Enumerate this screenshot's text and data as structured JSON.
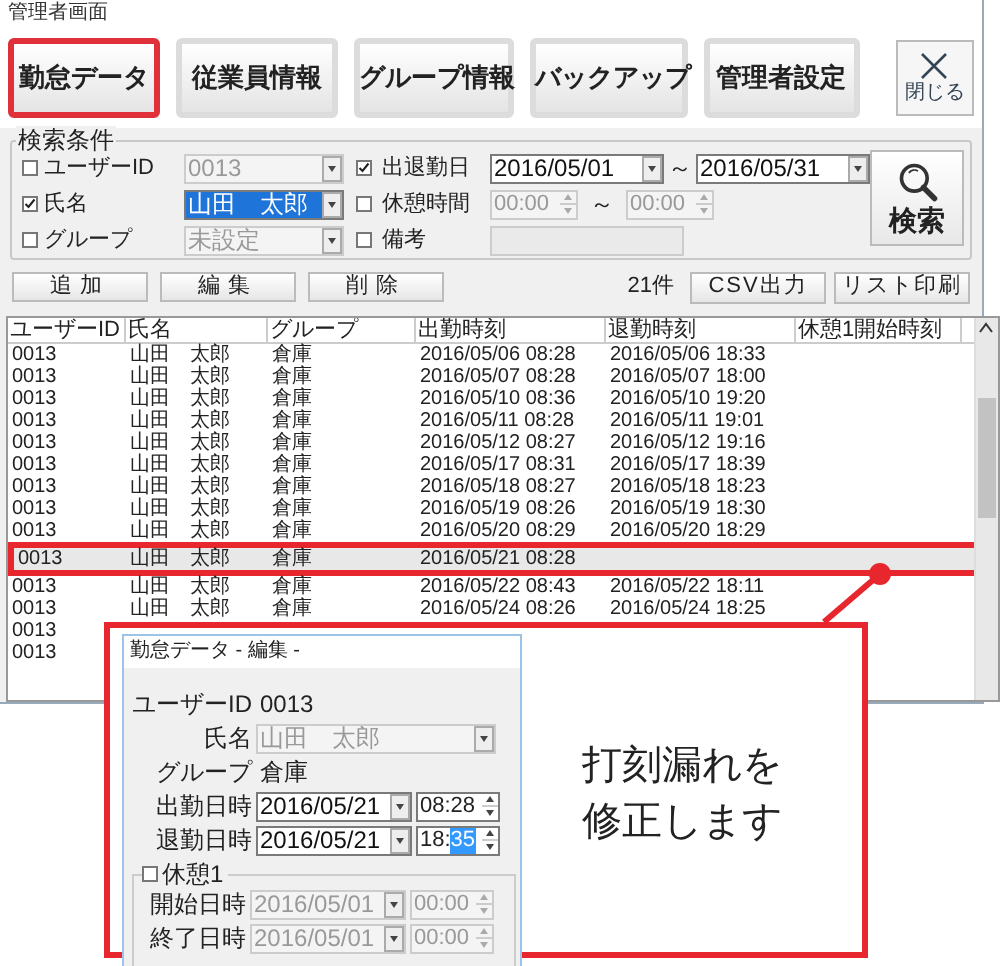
{
  "window": {
    "title": "管理者画面"
  },
  "toolbar": [
    {
      "label": "勤怠データ",
      "selected": true
    },
    {
      "label": "従業員情報",
      "selected": false
    },
    {
      "label": "グループ情報",
      "selected": false
    },
    {
      "label": "バックアップ",
      "selected": false
    },
    {
      "label": "管理者設定",
      "selected": false
    }
  ],
  "close_button": {
    "label": "閉じる"
  },
  "search": {
    "title": "検索条件",
    "button": "検索",
    "user_id": {
      "label": "ユーザーID",
      "checked": false,
      "value": "0013"
    },
    "name": {
      "label": "氏名",
      "checked": true,
      "value": "山田　太郎"
    },
    "group": {
      "label": "グループ",
      "checked": false,
      "value": "未設定"
    },
    "work_date": {
      "label": "出退勤日",
      "checked": true,
      "from": "2016/05/01",
      "separator": "～",
      "to": "2016/05/31"
    },
    "break_time": {
      "label": "休憩時間",
      "checked": false,
      "from": "00:00",
      "separator": "～",
      "to": "00:00"
    },
    "note": {
      "label": "備考",
      "checked": false
    }
  },
  "actions": [
    "追加",
    "編集",
    "削除"
  ],
  "count": "21件",
  "exports": [
    "CSV出力",
    "リスト印刷"
  ],
  "table": {
    "columns": [
      "ユーザーID",
      "氏名",
      "グループ",
      "出勤時刻",
      "退勤時刻",
      "休憩1開始時刻"
    ],
    "rows": [
      {
        "cells": [
          "0013",
          "山田　太郎",
          "倉庫",
          "2016/05/06 08:28",
          "2016/05/06 18:33"
        ],
        "selected": false
      },
      {
        "cells": [
          "0013",
          "山田　太郎",
          "倉庫",
          "2016/05/07 08:28",
          "2016/05/07 18:00"
        ],
        "selected": false
      },
      {
        "cells": [
          "0013",
          "山田　太郎",
          "倉庫",
          "2016/05/10 08:36",
          "2016/05/10 19:20"
        ],
        "selected": false
      },
      {
        "cells": [
          "0013",
          "山田　太郎",
          "倉庫",
          "2016/05/11 08:28",
          "2016/05/11 19:01"
        ],
        "selected": false
      },
      {
        "cells": [
          "0013",
          "山田　太郎",
          "倉庫",
          "2016/05/12 08:27",
          "2016/05/12 19:16"
        ],
        "selected": false
      },
      {
        "cells": [
          "0013",
          "山田　太郎",
          "倉庫",
          "2016/05/17 08:31",
          "2016/05/17 18:39"
        ],
        "selected": false
      },
      {
        "cells": [
          "0013",
          "山田　太郎",
          "倉庫",
          "2016/05/18 08:27",
          "2016/05/18 18:23"
        ],
        "selected": false
      },
      {
        "cells": [
          "0013",
          "山田　太郎",
          "倉庫",
          "2016/05/19 08:26",
          "2016/05/19 18:30"
        ],
        "selected": false
      },
      {
        "cells": [
          "0013",
          "山田　太郎",
          "倉庫",
          "2016/05/20 08:29",
          "2016/05/20 18:29"
        ],
        "selected": false
      },
      {
        "cells": [
          "0013",
          "山田　太郎",
          "倉庫",
          "2016/05/21 08:28"
        ],
        "selected": true
      },
      {
        "cells": [
          "0013",
          "山田　太郎",
          "倉庫",
          "2016/05/22 08:43",
          "2016/05/22 18:11"
        ],
        "selected": false
      },
      {
        "cells": [
          "0013",
          "山田　太郎",
          "倉庫",
          "2016/05/24 08:26",
          "2016/05/24 18:25"
        ],
        "selected": false
      },
      {
        "cells": [
          "0013"
        ],
        "selected": false
      },
      {
        "cells": [
          "0013"
        ],
        "selected": false
      }
    ]
  },
  "callout": {
    "message": [
      "打刻漏れを",
      "修正します"
    ],
    "dialog": {
      "title": "勤怠データ - 編集 -",
      "user_id": {
        "label": "ユーザーID",
        "value": "0013"
      },
      "name": {
        "label": "氏名",
        "value": "山田　太郎"
      },
      "group": {
        "label": "グループ",
        "value": "倉庫"
      },
      "clock_in": {
        "label": "出勤日時",
        "date": "2016/05/21",
        "time": "08:28"
      },
      "clock_out": {
        "label": "退勤日時",
        "date": "2016/05/21",
        "time": "18:",
        "time_selection": "35"
      },
      "break": {
        "label": "休憩1",
        "checked": false,
        "start": {
          "label": "開始日時",
          "date": "2016/05/01",
          "time": "00:00"
        },
        "end": {
          "label": "終了日時",
          "date": "2016/05/01",
          "time": "00:00"
        }
      }
    }
  }
}
